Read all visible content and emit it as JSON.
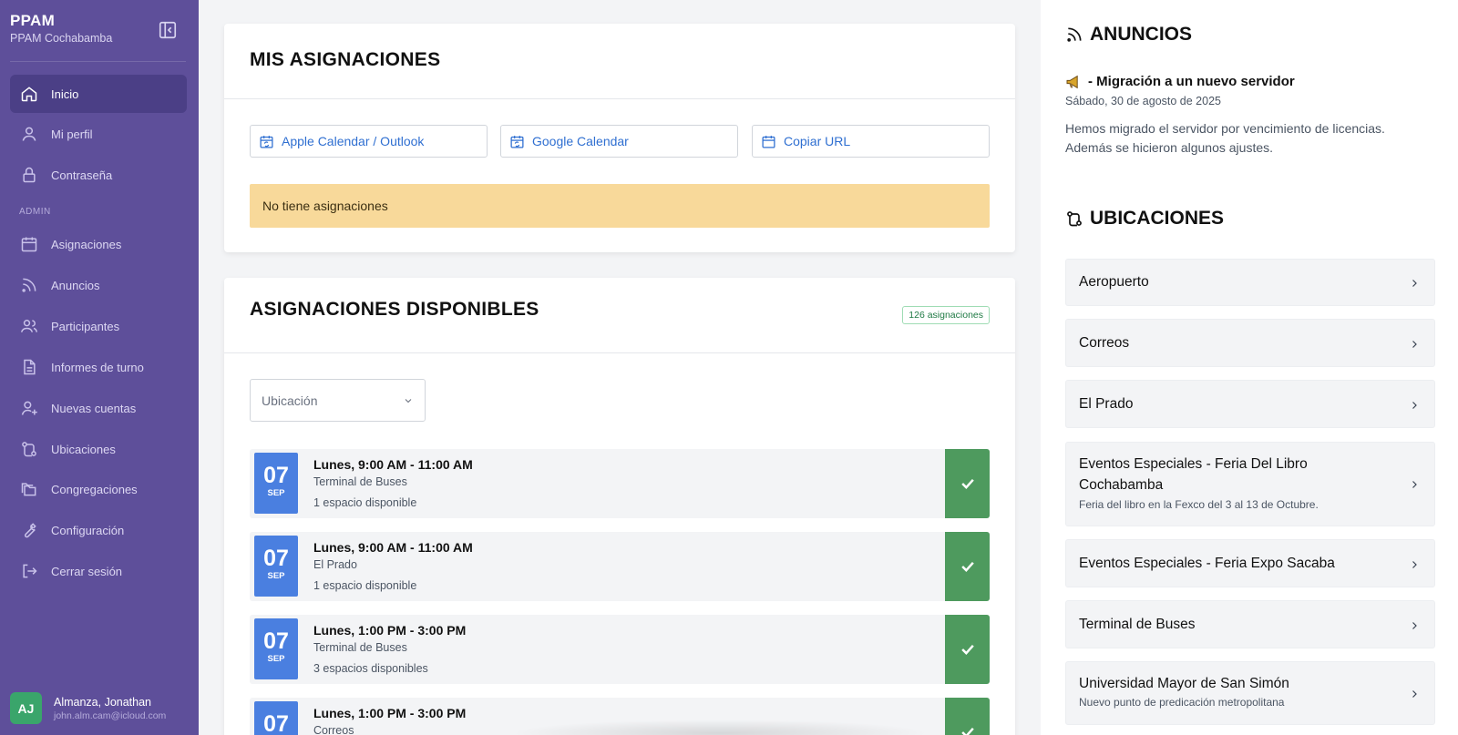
{
  "brand": {
    "title": "PPAM",
    "subtitle": "PPAM Cochabamba"
  },
  "sidebar": {
    "items": [
      {
        "label": "Inicio",
        "icon": "home-icon",
        "active": true
      },
      {
        "label": "Mi perfil",
        "icon": "user-icon"
      },
      {
        "label": "Contraseña",
        "icon": "lock-icon"
      }
    ],
    "admin_label": "ADMIN",
    "admin_items": [
      {
        "label": "Asignaciones",
        "icon": "calendar-icon"
      },
      {
        "label": "Anuncios",
        "icon": "rss-icon"
      },
      {
        "label": "Participantes",
        "icon": "users-icon"
      },
      {
        "label": "Informes de turno",
        "icon": "document-icon"
      },
      {
        "label": "Nuevas cuentas",
        "icon": "user-plus-icon"
      },
      {
        "label": "Ubicaciones",
        "icon": "route-icon"
      },
      {
        "label": "Congregaciones",
        "icon": "folders-icon"
      },
      {
        "label": "Configuración",
        "icon": "wrench-icon"
      },
      {
        "label": "Cerrar sesión",
        "icon": "logout-icon"
      }
    ],
    "user": {
      "initials": "AJ",
      "name": "Almanza, Jonathan",
      "email": "john.alm.cam@icloud.com"
    }
  },
  "mis_asignaciones": {
    "title": "MIS ASIGNACIONES",
    "buttons": [
      "Apple Calendar / Outlook",
      "Google Calendar",
      "Copiar URL"
    ],
    "empty_message": "No tiene asignaciones"
  },
  "disponibles": {
    "title": "ASIGNACIONES DISPONIBLES",
    "badge": "126 asignaciones",
    "filter_placeholder": "Ubicación",
    "slots": [
      {
        "day": "07",
        "month": "SEP",
        "time": "Lunes, 9:00 AM - 11:00 AM",
        "location": "Terminal de Buses",
        "availability": "1 espacio disponible"
      },
      {
        "day": "07",
        "month": "SEP",
        "time": "Lunes, 9:00 AM - 11:00 AM",
        "location": "El Prado",
        "availability": "1 espacio disponible"
      },
      {
        "day": "07",
        "month": "SEP",
        "time": "Lunes, 1:00 PM - 3:00 PM",
        "location": "Terminal de Buses",
        "availability": "3 espacios disponibles"
      },
      {
        "day": "07",
        "month": "",
        "time": "Lunes, 1:00 PM - 3:00 PM",
        "location": "Correos",
        "availability": ""
      }
    ]
  },
  "anuncios": {
    "title": "ANUNCIOS",
    "post": {
      "title": "- Migración a un nuevo servidor",
      "date": "Sábado, 30 de agosto de 2025",
      "body": "Hemos migrado el servidor por vencimiento de licencias. Además se hicieron algunos ajustes."
    }
  },
  "ubicaciones": {
    "title": "UBICACIONES",
    "items": [
      {
        "name": "Aeropuerto",
        "desc": ""
      },
      {
        "name": "Correos",
        "desc": ""
      },
      {
        "name": "El Prado",
        "desc": ""
      },
      {
        "name": "Eventos Especiales - Feria Del Libro Cochabamba",
        "desc": "Feria del libro en la Fexco del 3 al 13 de Octubre."
      },
      {
        "name": "Eventos Especiales - Feria Expo Sacaba",
        "desc": ""
      },
      {
        "name": "Terminal de Buses",
        "desc": ""
      },
      {
        "name": "Universidad Mayor de San Simón",
        "desc": "Nuevo punto de predicación metropolitana"
      }
    ]
  },
  "colors": {
    "sidebar": "#5e4f9a",
    "accent": "#4a7fe0",
    "success": "#4e9a5e",
    "warning": "#f8d99a"
  }
}
